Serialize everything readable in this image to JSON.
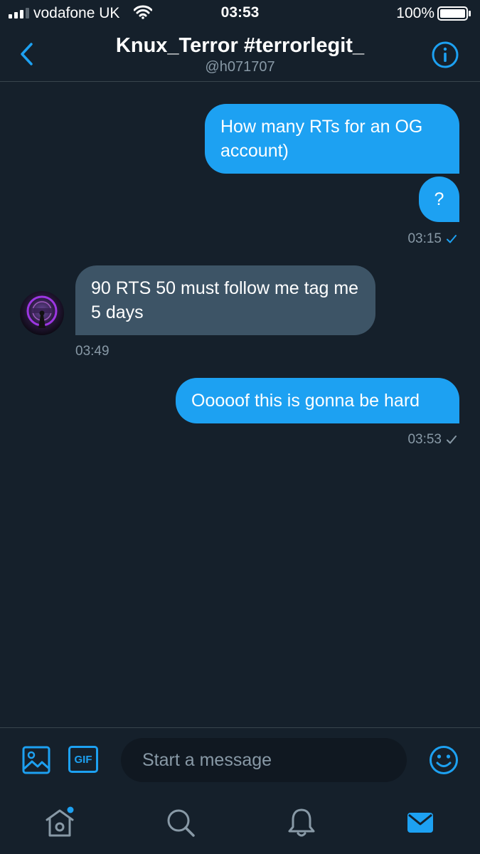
{
  "status_bar": {
    "carrier": "vodafone UK",
    "time": "03:53",
    "battery": "100%"
  },
  "header": {
    "title": "Knux_Terror #terrorlegit_",
    "handle": "@h071707"
  },
  "messages": [
    {
      "direction": "outgoing",
      "text": "How many RTs for an OG account)"
    },
    {
      "direction": "outgoing",
      "text": "?",
      "time": "03:15",
      "read": true
    },
    {
      "direction": "incoming",
      "text": "90 RTS 50 must follow me tag me 5 days",
      "time": "03:49"
    },
    {
      "direction": "outgoing",
      "text": "Ooooof this is gonna be hard",
      "time": "03:53",
      "read": false
    }
  ],
  "composer": {
    "gif_label": "GIF",
    "placeholder": "Start a message"
  },
  "colors": {
    "background": "#15202b",
    "accent": "#1da1f2",
    "incoming_bubble": "#3d5466",
    "muted_text": "#8899a6",
    "divider": "#38444d"
  },
  "icons": {
    "back": "chevron-left-icon",
    "info": "info-icon",
    "image": "image-icon",
    "emoji": "smiley-icon",
    "home": "home-icon",
    "search": "search-icon",
    "notifications": "bell-icon",
    "messages": "envelope-icon"
  }
}
